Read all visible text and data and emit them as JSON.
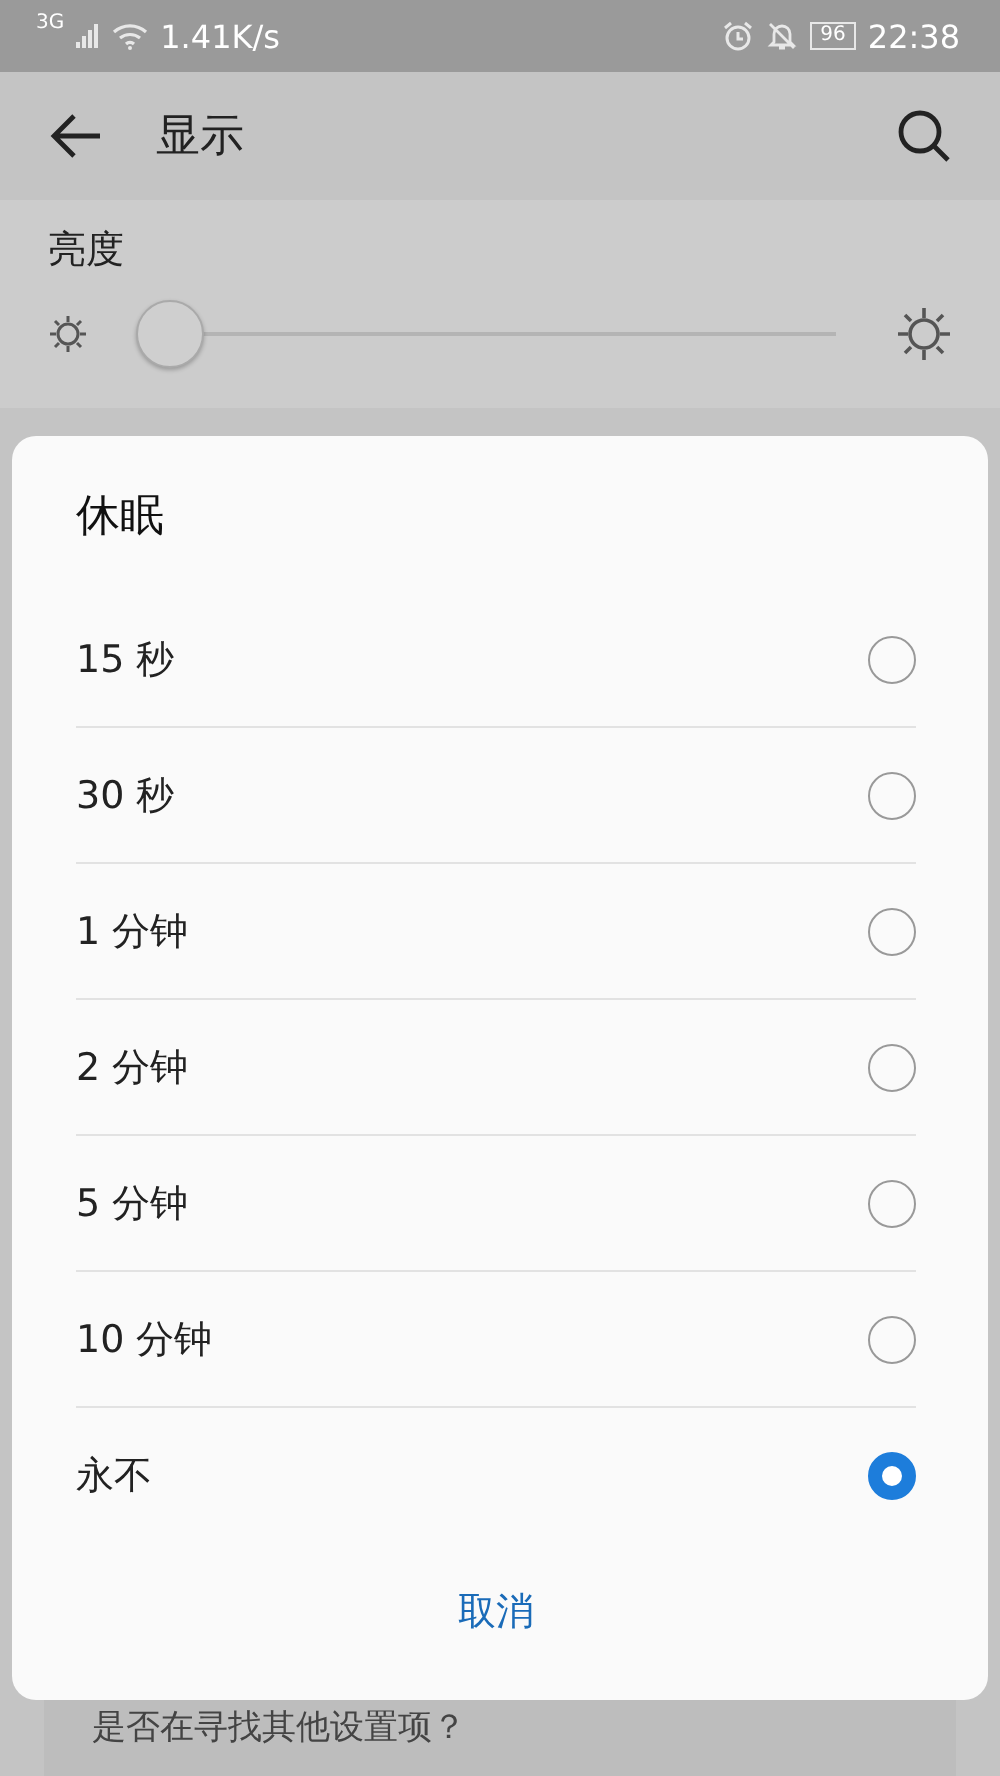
{
  "status_bar": {
    "network": "3G",
    "speed": "1.41K/s",
    "battery": "96",
    "time": "22:38"
  },
  "toolbar": {
    "title": "显示"
  },
  "brightness": {
    "label": "亮度",
    "level": 0
  },
  "hint": {
    "text": "是否在寻找其他设置项？"
  },
  "dialog": {
    "title": "休眠",
    "options": [
      {
        "label": "15 秒",
        "selected": false
      },
      {
        "label": "30 秒",
        "selected": false
      },
      {
        "label": "1 分钟",
        "selected": false
      },
      {
        "label": "2 分钟",
        "selected": false
      },
      {
        "label": "5 分钟",
        "selected": false
      },
      {
        "label": "10 分钟",
        "selected": false
      },
      {
        "label": "永不",
        "selected": true
      }
    ],
    "cancel": "取消"
  }
}
